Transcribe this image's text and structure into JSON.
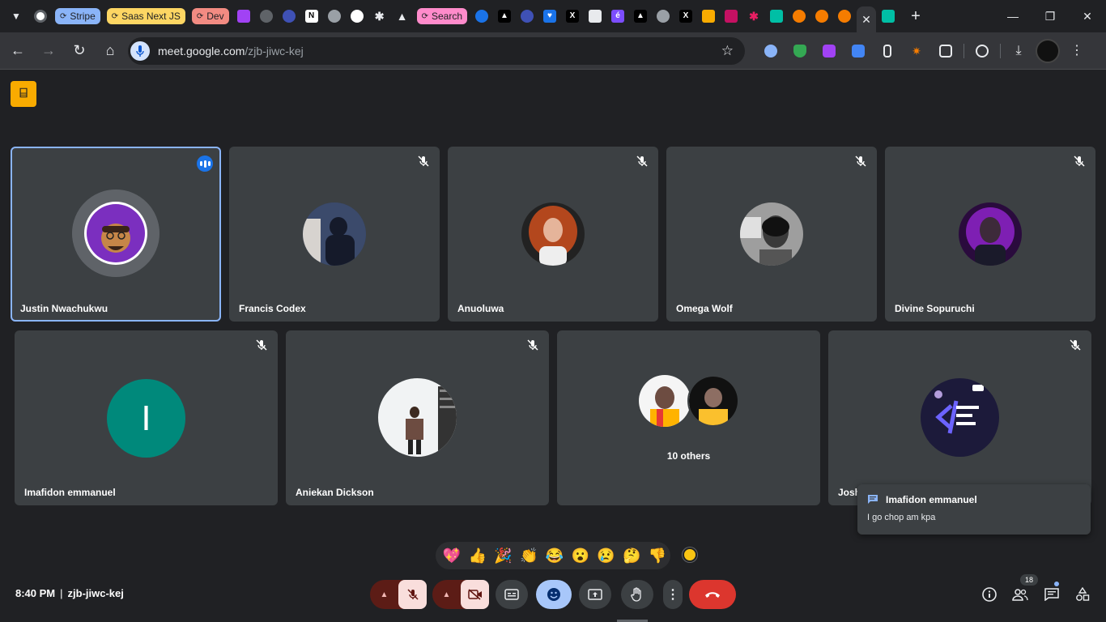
{
  "browser": {
    "tab_groups": [
      {
        "label": "Stripe",
        "color": "#8ab4f8"
      },
      {
        "label": "Saas Next JS",
        "color": "#fdd663"
      },
      {
        "label": "Dev",
        "color": "#f28b82"
      },
      {
        "label": "Search",
        "color": "#ff8bcb"
      }
    ],
    "url_host": "meet.google.com",
    "url_path": "/zjb-jiwc-kej"
  },
  "meet": {
    "meeting_code": "zjb-jiwc-kej",
    "time": "8:40 PM",
    "participants": [
      {
        "name": "Justin Nwachukwu",
        "speaking": true
      },
      {
        "name": "Francis Codex",
        "muted": true
      },
      {
        "name": "Anuoluwa",
        "muted": true
      },
      {
        "name": "Omega Wolf",
        "muted": true
      },
      {
        "name": "Divine Sopuruchi",
        "muted": true
      },
      {
        "name": "Imafidon emmanuel",
        "initial": "I",
        "avatar_color": "#00897b",
        "muted": true
      },
      {
        "name": "Aniekan Dickson",
        "muted": true
      },
      {
        "name": "Josh",
        "muted": true
      }
    ],
    "others_label": "10 others",
    "toast": {
      "sender": "Imafidon emmanuel",
      "message": "I go chop am kpa"
    },
    "reactions": [
      "💖",
      "👍",
      "🎉",
      "👏",
      "😂",
      "😮",
      "😢",
      "🤔",
      "👎"
    ],
    "participant_count": "18"
  }
}
